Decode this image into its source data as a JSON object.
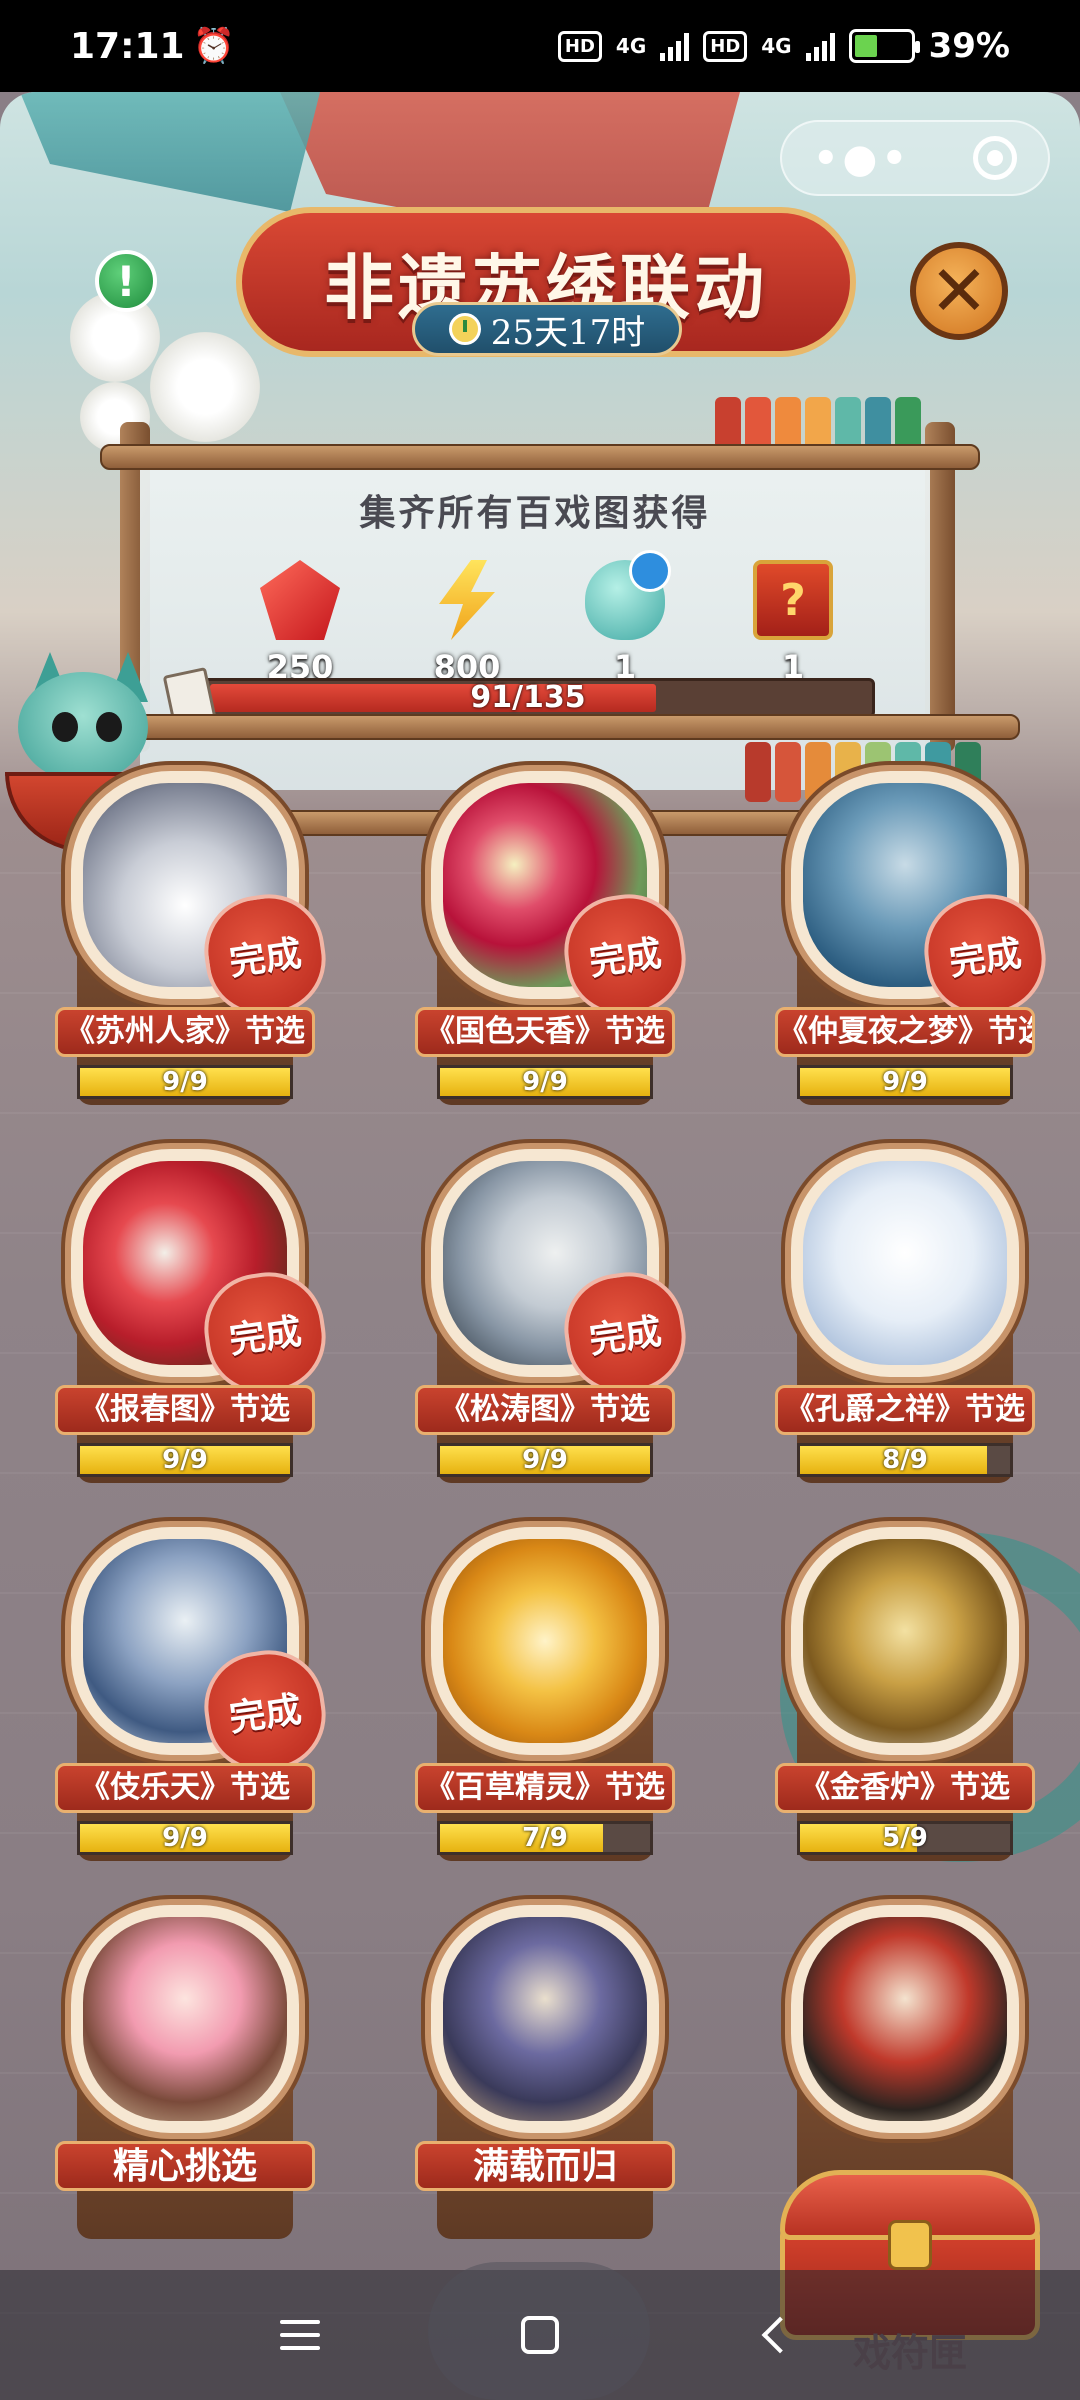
{
  "status_bar": {
    "time": "17:11",
    "network_1": "4G",
    "network_2": "4G",
    "hd_1": "HD",
    "hd_2": "HD",
    "battery": "39%"
  },
  "event": {
    "title": "非遗苏绣联动",
    "timer": "25天17时",
    "reward_title": "集齐所有百戏图获得",
    "rewards": [
      {
        "name": "gem",
        "count": "250"
      },
      {
        "name": "energy",
        "count": "800"
      },
      {
        "name": "egg",
        "count": "1"
      },
      {
        "name": "mystery-chest",
        "count": "1"
      }
    ],
    "progress_text": "91/135",
    "progress_fraction": 0.674
  },
  "cards": [
    {
      "label": "《苏州人家》节选",
      "progress": "9/9",
      "fraction": 1.0,
      "done": "完成"
    },
    {
      "label": "《国色天香》节选",
      "progress": "9/9",
      "fraction": 1.0,
      "done": "完成"
    },
    {
      "label": "《仲夏夜之梦》节选",
      "progress": "9/9",
      "fraction": 1.0,
      "done": "完成"
    },
    {
      "label": "《报春图》节选",
      "progress": "9/9",
      "fraction": 1.0,
      "done": "完成"
    },
    {
      "label": "《松涛图》节选",
      "progress": "9/9",
      "fraction": 1.0,
      "done": "完成"
    },
    {
      "label": "《孔爵之祥》节选",
      "progress": "8/9",
      "fraction": 0.889,
      "done": ""
    },
    {
      "label": "《伎乐天》节选",
      "progress": "9/9",
      "fraction": 1.0,
      "done": "完成"
    },
    {
      "label": "《百草精灵》节选",
      "progress": "7/9",
      "fraction": 0.778,
      "done": ""
    },
    {
      "label": "《金香炉》节选",
      "progress": "5/9",
      "fraction": 0.556,
      "done": ""
    },
    {
      "label": "精心挑选",
      "progress": "",
      "fraction": null,
      "done": ""
    },
    {
      "label": "满载而归",
      "progress": "",
      "fraction": null,
      "done": ""
    }
  ],
  "chest": {
    "label": "戏符匣"
  },
  "colors": {
    "accent_red": "#c9432e",
    "gold": "#e9b06f",
    "progress_yellow": "#ffe04d"
  }
}
